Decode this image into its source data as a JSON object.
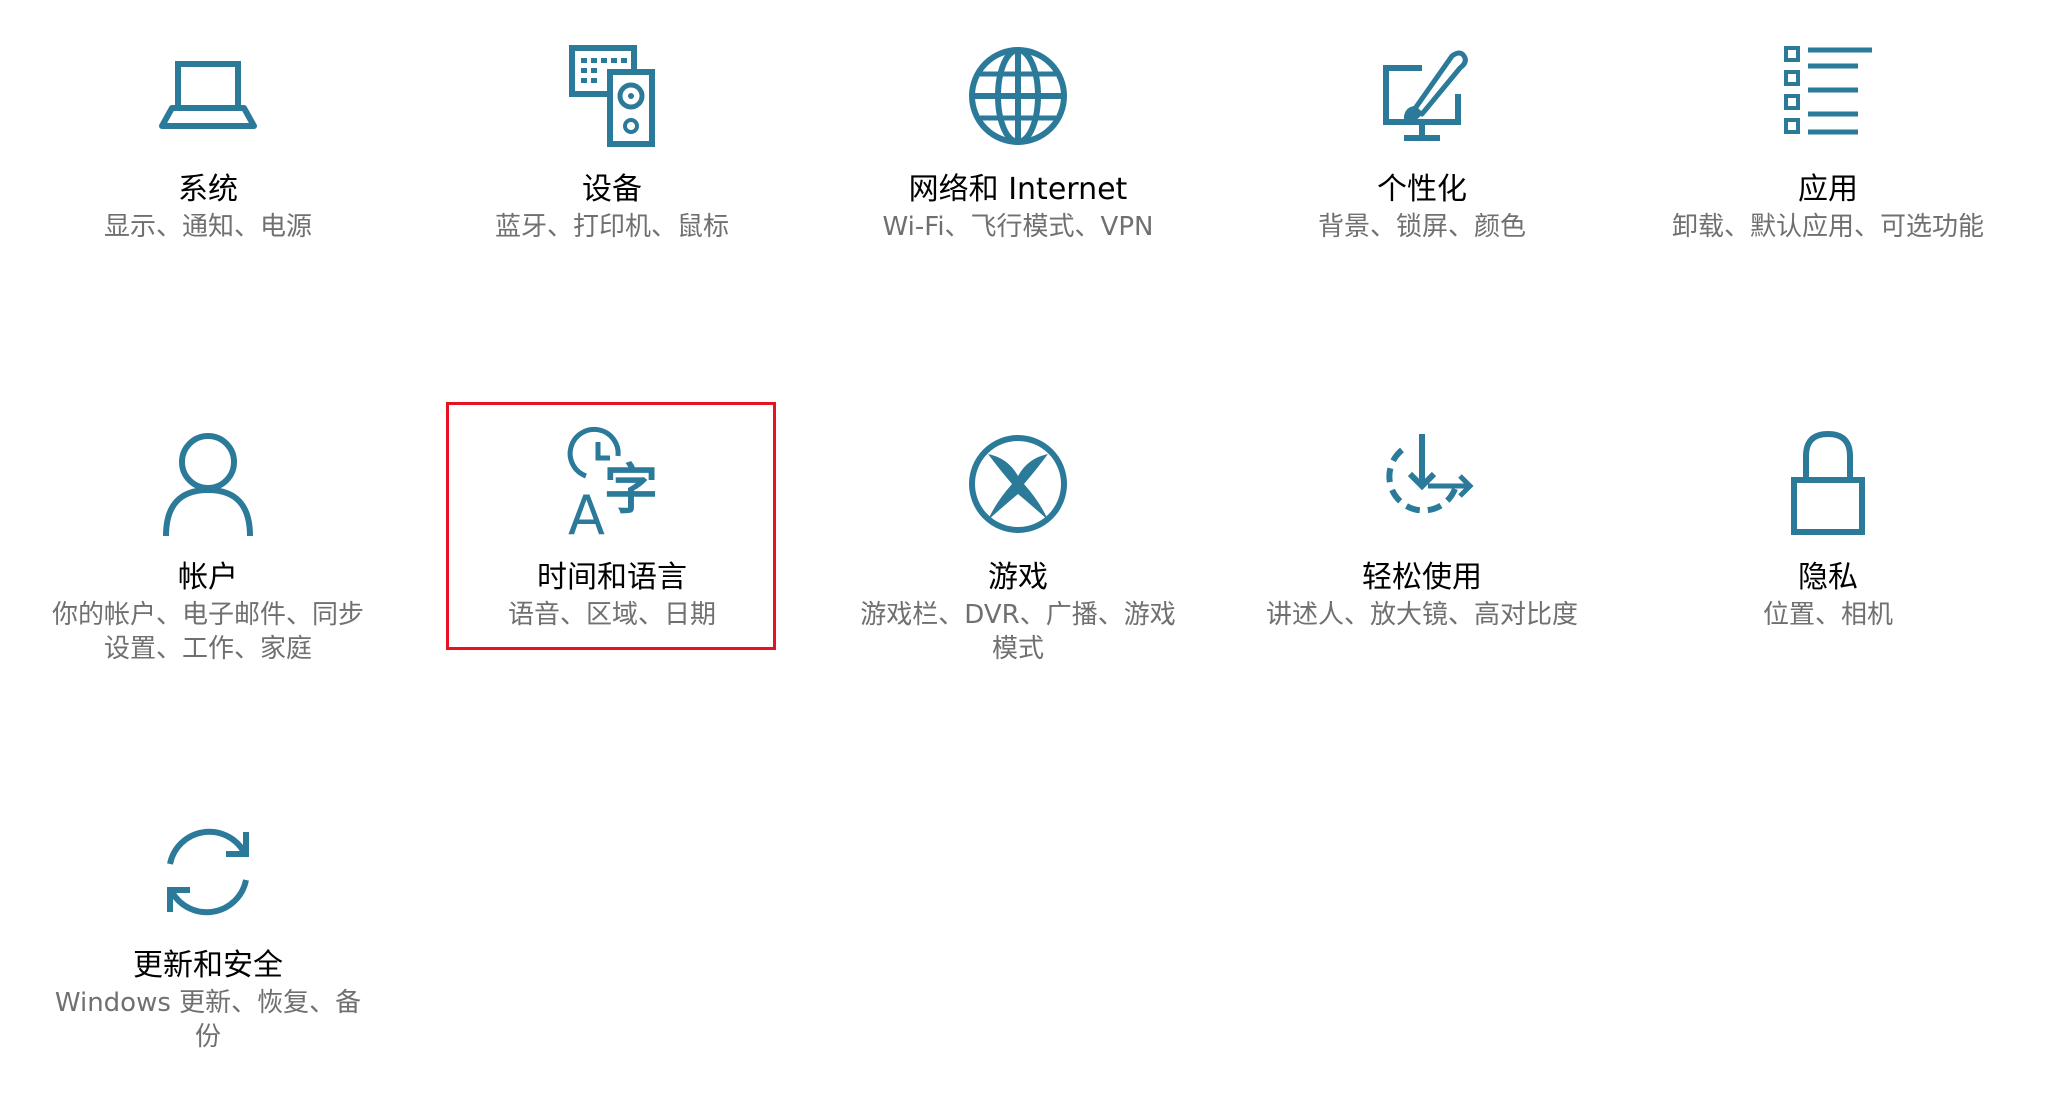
{
  "accent_color": "#2b7a99",
  "highlight_color": "#e81123",
  "tiles": [
    {
      "icon": "laptop-icon",
      "title": "系统",
      "desc": "显示、通知、电源"
    },
    {
      "icon": "devices-icon",
      "title": "设备",
      "desc": "蓝牙、打印机、鼠标"
    },
    {
      "icon": "globe-icon",
      "title": "网络和 Internet",
      "desc": "Wi-Fi、飞行模式、VPN"
    },
    {
      "icon": "personalization-icon",
      "title": "个性化",
      "desc": "背景、锁屏、颜色"
    },
    {
      "icon": "apps-list-icon",
      "title": "应用",
      "desc": "卸载、默认应用、可选功能"
    },
    {
      "icon": "person-icon",
      "title": "帐户",
      "desc": "你的帐户、电子邮件、同步设置、工作、家庭"
    },
    {
      "icon": "time-language-icon",
      "title": "时间和语言",
      "desc": "语音、区域、日期"
    },
    {
      "icon": "xbox-icon",
      "title": "游戏",
      "desc": "游戏栏、DVR、广播、游戏模式"
    },
    {
      "icon": "ease-of-access-icon",
      "title": "轻松使用",
      "desc": "讲述人、放大镜、高对比度"
    },
    {
      "icon": "lock-icon",
      "title": "隐私",
      "desc": "位置、相机"
    },
    {
      "icon": "sync-icon",
      "title": "更新和安全",
      "desc": "Windows 更新、恢复、备份"
    }
  ],
  "time_icon_glyphs": {
    "latin": "A",
    "cjk": "字"
  }
}
